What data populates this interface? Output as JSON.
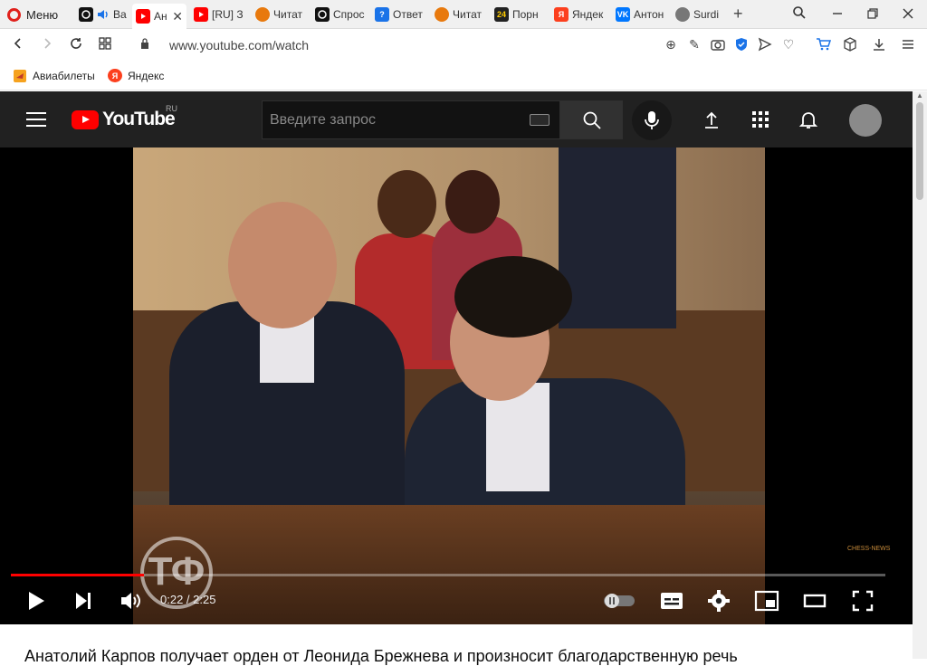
{
  "browser": {
    "menu_label": "Меню",
    "tabs": [
      {
        "label": "Ва",
        "icon": "chatgpt-icon",
        "color": "#111111"
      },
      {
        "label": "Ан",
        "icon": "youtube-icon",
        "color": "#ff0000",
        "active": true
      },
      {
        "label": "[RU] З",
        "icon": "youtube-icon",
        "color": "#ff0000"
      },
      {
        "label": "Читат",
        "icon": "orange-circle-icon",
        "color": "#e8790d"
      },
      {
        "label": "Спрос",
        "icon": "chatgpt-icon",
        "color": "#111111"
      },
      {
        "label": "Ответ",
        "icon": "question-icon",
        "color": "#1a73e8"
      },
      {
        "label": "Читат",
        "icon": "orange-circle-icon",
        "color": "#e8790d"
      },
      {
        "label": "Порн",
        "icon": "24-icon",
        "color": "#222222"
      },
      {
        "label": "Яндек",
        "icon": "yandex-icon",
        "color": "#fc3f1d"
      },
      {
        "label": "Антон",
        "icon": "vk-icon",
        "color": "#0077ff"
      },
      {
        "label": "Surdi",
        "icon": "globe-icon",
        "color": "#777777"
      }
    ],
    "url": "www.youtube.com/watch",
    "bookmarks": [
      {
        "label": "Авиабилеты",
        "icon": "flights-icon"
      },
      {
        "label": "Яндекс",
        "icon": "yandex-icon"
      }
    ]
  },
  "youtube": {
    "logo_text": "YouTube",
    "region": "RU",
    "search_placeholder": "Введите запрос"
  },
  "player": {
    "current_time": "0:22",
    "duration": "2:25",
    "progress_fraction": 0.152,
    "watermark": "CHESS-NEWS"
  },
  "video_title": "Анатолий Карпов получает орден от Леонида Брежнева и произносит благодарственную речь"
}
